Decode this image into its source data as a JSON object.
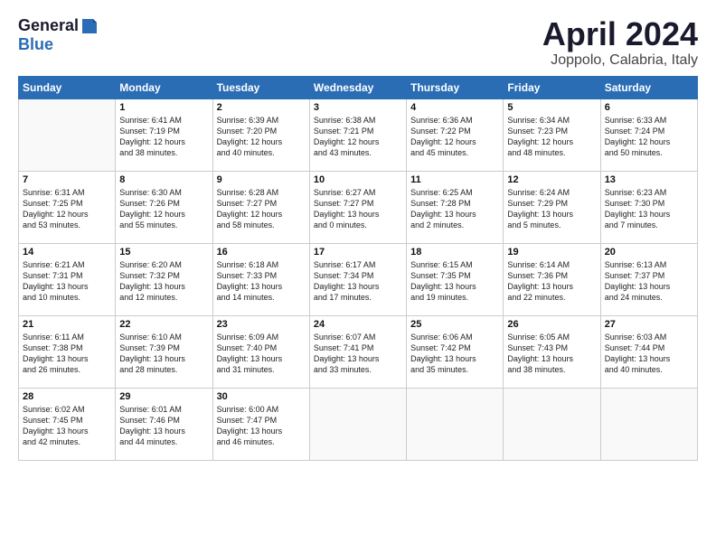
{
  "header": {
    "logo_general": "General",
    "logo_blue": "Blue",
    "title": "April 2024",
    "location": "Joppolo, Calabria, Italy"
  },
  "columns": [
    "Sunday",
    "Monday",
    "Tuesday",
    "Wednesday",
    "Thursday",
    "Friday",
    "Saturday"
  ],
  "weeks": [
    [
      {
        "day": "",
        "info": ""
      },
      {
        "day": "1",
        "info": "Sunrise: 6:41 AM\nSunset: 7:19 PM\nDaylight: 12 hours\nand 38 minutes."
      },
      {
        "day": "2",
        "info": "Sunrise: 6:39 AM\nSunset: 7:20 PM\nDaylight: 12 hours\nand 40 minutes."
      },
      {
        "day": "3",
        "info": "Sunrise: 6:38 AM\nSunset: 7:21 PM\nDaylight: 12 hours\nand 43 minutes."
      },
      {
        "day": "4",
        "info": "Sunrise: 6:36 AM\nSunset: 7:22 PM\nDaylight: 12 hours\nand 45 minutes."
      },
      {
        "day": "5",
        "info": "Sunrise: 6:34 AM\nSunset: 7:23 PM\nDaylight: 12 hours\nand 48 minutes."
      },
      {
        "day": "6",
        "info": "Sunrise: 6:33 AM\nSunset: 7:24 PM\nDaylight: 12 hours\nand 50 minutes."
      }
    ],
    [
      {
        "day": "7",
        "info": "Sunrise: 6:31 AM\nSunset: 7:25 PM\nDaylight: 12 hours\nand 53 minutes."
      },
      {
        "day": "8",
        "info": "Sunrise: 6:30 AM\nSunset: 7:26 PM\nDaylight: 12 hours\nand 55 minutes."
      },
      {
        "day": "9",
        "info": "Sunrise: 6:28 AM\nSunset: 7:27 PM\nDaylight: 12 hours\nand 58 minutes."
      },
      {
        "day": "10",
        "info": "Sunrise: 6:27 AM\nSunset: 7:27 PM\nDaylight: 13 hours\nand 0 minutes."
      },
      {
        "day": "11",
        "info": "Sunrise: 6:25 AM\nSunset: 7:28 PM\nDaylight: 13 hours\nand 2 minutes."
      },
      {
        "day": "12",
        "info": "Sunrise: 6:24 AM\nSunset: 7:29 PM\nDaylight: 13 hours\nand 5 minutes."
      },
      {
        "day": "13",
        "info": "Sunrise: 6:23 AM\nSunset: 7:30 PM\nDaylight: 13 hours\nand 7 minutes."
      }
    ],
    [
      {
        "day": "14",
        "info": "Sunrise: 6:21 AM\nSunset: 7:31 PM\nDaylight: 13 hours\nand 10 minutes."
      },
      {
        "day": "15",
        "info": "Sunrise: 6:20 AM\nSunset: 7:32 PM\nDaylight: 13 hours\nand 12 minutes."
      },
      {
        "day": "16",
        "info": "Sunrise: 6:18 AM\nSunset: 7:33 PM\nDaylight: 13 hours\nand 14 minutes."
      },
      {
        "day": "17",
        "info": "Sunrise: 6:17 AM\nSunset: 7:34 PM\nDaylight: 13 hours\nand 17 minutes."
      },
      {
        "day": "18",
        "info": "Sunrise: 6:15 AM\nSunset: 7:35 PM\nDaylight: 13 hours\nand 19 minutes."
      },
      {
        "day": "19",
        "info": "Sunrise: 6:14 AM\nSunset: 7:36 PM\nDaylight: 13 hours\nand 22 minutes."
      },
      {
        "day": "20",
        "info": "Sunrise: 6:13 AM\nSunset: 7:37 PM\nDaylight: 13 hours\nand 24 minutes."
      }
    ],
    [
      {
        "day": "21",
        "info": "Sunrise: 6:11 AM\nSunset: 7:38 PM\nDaylight: 13 hours\nand 26 minutes."
      },
      {
        "day": "22",
        "info": "Sunrise: 6:10 AM\nSunset: 7:39 PM\nDaylight: 13 hours\nand 28 minutes."
      },
      {
        "day": "23",
        "info": "Sunrise: 6:09 AM\nSunset: 7:40 PM\nDaylight: 13 hours\nand 31 minutes."
      },
      {
        "day": "24",
        "info": "Sunrise: 6:07 AM\nSunset: 7:41 PM\nDaylight: 13 hours\nand 33 minutes."
      },
      {
        "day": "25",
        "info": "Sunrise: 6:06 AM\nSunset: 7:42 PM\nDaylight: 13 hours\nand 35 minutes."
      },
      {
        "day": "26",
        "info": "Sunrise: 6:05 AM\nSunset: 7:43 PM\nDaylight: 13 hours\nand 38 minutes."
      },
      {
        "day": "27",
        "info": "Sunrise: 6:03 AM\nSunset: 7:44 PM\nDaylight: 13 hours\nand 40 minutes."
      }
    ],
    [
      {
        "day": "28",
        "info": "Sunrise: 6:02 AM\nSunset: 7:45 PM\nDaylight: 13 hours\nand 42 minutes."
      },
      {
        "day": "29",
        "info": "Sunrise: 6:01 AM\nSunset: 7:46 PM\nDaylight: 13 hours\nand 44 minutes."
      },
      {
        "day": "30",
        "info": "Sunrise: 6:00 AM\nSunset: 7:47 PM\nDaylight: 13 hours\nand 46 minutes."
      },
      {
        "day": "",
        "info": ""
      },
      {
        "day": "",
        "info": ""
      },
      {
        "day": "",
        "info": ""
      },
      {
        "day": "",
        "info": ""
      }
    ]
  ]
}
